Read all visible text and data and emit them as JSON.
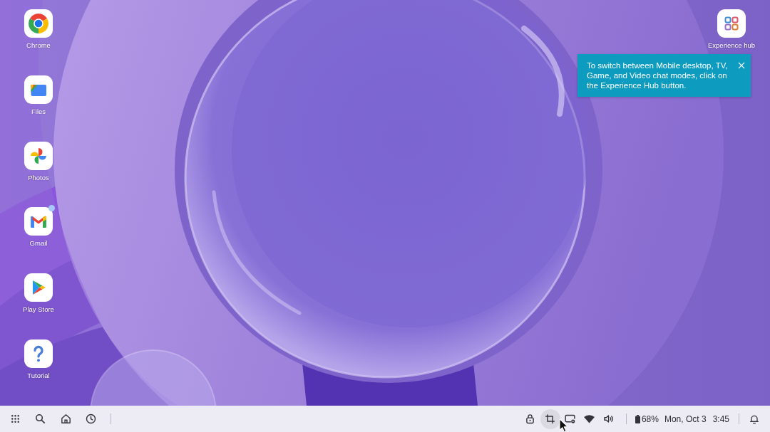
{
  "desktop": {
    "apps": [
      {
        "label": "Chrome",
        "kind": "chrome",
        "notification": false
      },
      {
        "label": "Files",
        "kind": "files",
        "notification": false
      },
      {
        "label": "Photos",
        "kind": "photos",
        "notification": false
      },
      {
        "label": "Gmail",
        "kind": "gmail",
        "notification": true
      },
      {
        "label": "Play Store",
        "kind": "play",
        "notification": false
      },
      {
        "label": "Tutorial",
        "kind": "help",
        "notification": false
      }
    ],
    "pinned_right": [
      {
        "label": "Experience hub",
        "kind": "hub",
        "notification": false
      }
    ]
  },
  "tooltip": {
    "text": "To switch between Mobile desktop, TV, Game, and Video chat modes, click on the Experience Hub button."
  },
  "taskbar": {
    "nav_buttons": [
      {
        "kind": "apps"
      },
      {
        "kind": "search"
      },
      {
        "kind": "home"
      },
      {
        "kind": "recents"
      }
    ],
    "tray_buttons": [
      {
        "kind": "lock",
        "highlighted": false
      },
      {
        "kind": "screenshot",
        "highlighted": true
      },
      {
        "kind": "display",
        "highlighted": false
      },
      {
        "kind": "wifi",
        "highlighted": false
      },
      {
        "kind": "volume",
        "highlighted": false
      }
    ],
    "battery": "68%",
    "date": "Mon, Oct 3",
    "time": "3:45"
  }
}
